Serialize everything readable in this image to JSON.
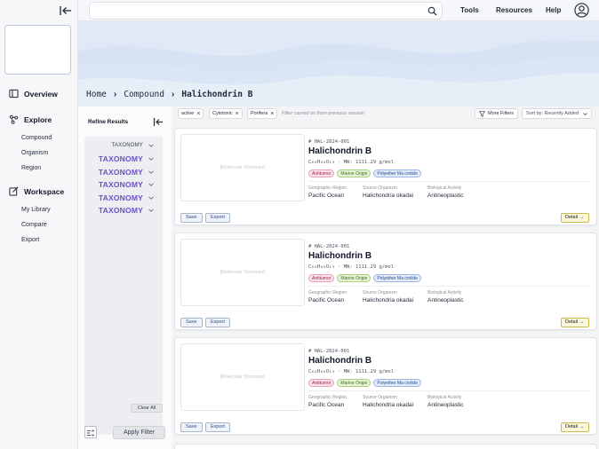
{
  "topbar": {
    "search_placeholder": "",
    "links": [
      "Tools",
      "Resources",
      "Help"
    ]
  },
  "sidebar": {
    "overview": "Overview",
    "explore": {
      "label": "Explore",
      "items": [
        "Compound",
        "Organism",
        "Region"
      ]
    },
    "workspace": {
      "label": "Workspace",
      "items": [
        "My Library",
        "Compare",
        "Export"
      ]
    }
  },
  "breadcrumb": [
    "Home",
    "Compound",
    "Halichondrin B"
  ],
  "refine": {
    "title": "Refine Results",
    "facets": [
      {
        "label": "TAXONOMY",
        "style": "small"
      },
      {
        "label": "TAXONOMY",
        "style": "big"
      },
      {
        "label": "TAXONOMY",
        "style": "big"
      },
      {
        "label": "TAXONOMY",
        "style": "big"
      },
      {
        "label": "TAXONOMY",
        "style": "big"
      },
      {
        "label": "TAXONOMY",
        "style": "big"
      }
    ],
    "clear_all": "Clear All",
    "apply_filter": "Apply Filter"
  },
  "filters": {
    "chips": [
      "active",
      "Cytotoxic",
      "Porifera"
    ],
    "note": "Filter carried on from previous session",
    "more_filters": "More Filters",
    "sort": "Sort by: Recently Added"
  },
  "results": [
    {
      "structure_placeholder": "[Molecular Structure]",
      "id": "# HAL-2024-001",
      "name": "Halichondrin B",
      "formula": "C₆₀H₈₆O₁₉ · MW: 1111.29 g/mol",
      "tags": [
        {
          "text": "Antitumor",
          "color": "red"
        },
        {
          "text": "Marine Origin",
          "color": "green"
        },
        {
          "text": "Polyether Ma crolide",
          "color": "blue"
        }
      ],
      "meta": [
        {
          "label": "Geographic Region",
          "value": "Pacific Ocean"
        },
        {
          "label": "Source Organism",
          "value": "Halichondria okadai"
        },
        {
          "label": "Biological Activity",
          "value": "Antineoplastic"
        }
      ],
      "save": "Save",
      "export": "Export",
      "detail": "Detail"
    },
    {
      "structure_placeholder": "[Molecular Structure]",
      "id": "# HAL-2024-001",
      "name": "Halichondrin B",
      "formula": "C₆₀H₈₆O₁₉ · MW: 1111.29 g/mol",
      "tags": [
        {
          "text": "Antitumor",
          "color": "red"
        },
        {
          "text": "Marine Origin",
          "color": "green"
        },
        {
          "text": "Polyether Ma crolide",
          "color": "blue"
        }
      ],
      "meta": [
        {
          "label": "Geographic Region",
          "value": "Pacific Ocean"
        },
        {
          "label": "Source Organism",
          "value": "Halichondria okadai"
        },
        {
          "label": "Biological Activity",
          "value": "Antineoplastic"
        }
      ],
      "save": "Save",
      "export": "Export",
      "detail": "Detail"
    },
    {
      "structure_placeholder": "[Molecular Structure]",
      "id": "# HAL-2024-001",
      "name": "Halichondrin B",
      "formula": "C₆₀H₈₆O₁₉ · MW: 1111.29 g/mol",
      "tags": [
        {
          "text": "Antitumor",
          "color": "red"
        },
        {
          "text": "Marine Origin",
          "color": "green"
        },
        {
          "text": "Polyether Ma crolide",
          "color": "blue"
        }
      ],
      "meta": [
        {
          "label": "Geographic Region",
          "value": "Pacific Ocean"
        },
        {
          "label": "Source Organism",
          "value": "Halichondria okadai"
        },
        {
          "label": "Biological Activity",
          "value": "Antineoplastic"
        }
      ],
      "save": "Save",
      "export": "Export",
      "detail": "Detail"
    }
  ]
}
